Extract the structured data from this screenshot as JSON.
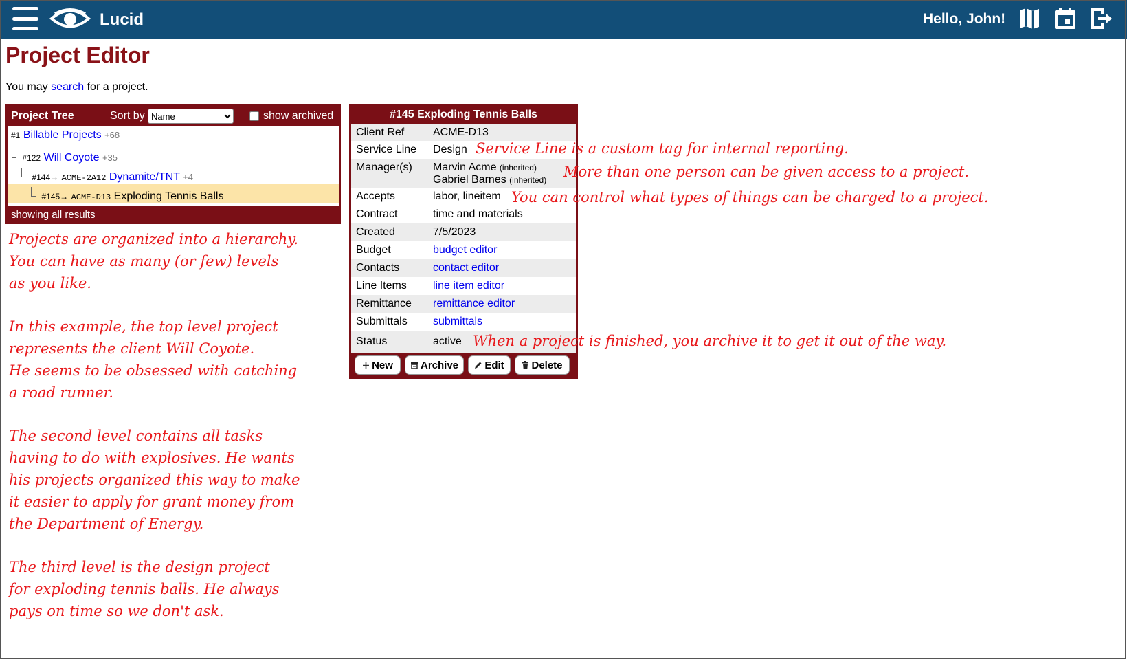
{
  "app": {
    "name": "Lucid",
    "greeting": "Hello, John!"
  },
  "header_icons": [
    "hamburger-menu-icon",
    "eye-logo-icon",
    "map-icon",
    "calendar-icon",
    "logout-icon"
  ],
  "page": {
    "title": "Project Editor",
    "intro": {
      "before": "You may ",
      "link": "search",
      "after": " for a project."
    }
  },
  "tree": {
    "title": "Project Tree",
    "sort_label": "Sort by",
    "sort_value": "Name",
    "show_archived_label": "show archived",
    "show_archived_checked": false,
    "rows": [
      {
        "num": "#1",
        "ref": "",
        "name": "Billable Projects",
        "count": "+68",
        "selected": false,
        "is_link": true
      },
      {
        "num": "#122",
        "ref": "",
        "name": "Will Coyote",
        "count": "+35",
        "selected": false,
        "is_link": true
      },
      {
        "num": "#144→",
        "ref": "ACME-2A12",
        "name": "Dynamite/TNT",
        "count": "+4",
        "selected": false,
        "is_link": true
      },
      {
        "num": "#145→",
        "ref": "ACME-D13",
        "name": "Exploding Tennis Balls",
        "count": "",
        "selected": true,
        "is_link": false
      }
    ],
    "footer": "showing all results"
  },
  "details": {
    "title": "#145 Exploding Tennis Balls",
    "client_ref": {
      "label": "Client Ref",
      "value": "ACME-D13"
    },
    "service_line": {
      "label": "Service Line",
      "value": "Design"
    },
    "managers": {
      "label": "Manager(s)",
      "people": [
        {
          "name": "Marvin Acme",
          "note": "(inherited)"
        },
        {
          "name": "Gabriel Barnes",
          "note": "(inherited)"
        }
      ]
    },
    "accepts": {
      "label": "Accepts",
      "value": "labor, lineitem"
    },
    "contract": {
      "label": "Contract",
      "value": "time and materials"
    },
    "created": {
      "label": "Created",
      "value": "7/5/2023"
    },
    "budget": {
      "label": "Budget",
      "value": "budget editor"
    },
    "contacts": {
      "label": "Contacts",
      "value": "contact editor"
    },
    "line_items": {
      "label": "Line Items",
      "value": "line item editor"
    },
    "remittance": {
      "label": "Remittance",
      "value": "remittance editor"
    },
    "submittals": {
      "label": "Submittals",
      "value": "submittals"
    },
    "status": {
      "label": "Status",
      "value": "active"
    }
  },
  "actions": {
    "new": "New",
    "archive": "Archive",
    "edit": "Edit",
    "delete": "Delete"
  },
  "annotations": {
    "service_line": "Service Line is a custom tag for internal reporting.",
    "managers": "More than one person can be given access to a project.",
    "accepts": "You can control what types of things can be charged to a project.",
    "status": "When a project is finished, you archive it to get it out of the way.",
    "hierarchy": "Projects are organized into a hierarchy.\nYou can have as many (or few) levels\nas you like.",
    "top_level": "In this example, the top level project\nrepresents the client Will Coyote.\nHe seems to be obsessed with catching\na road runner.",
    "second_level": "The second level contains all tasks\nhaving to do with explosives. He wants\nhis projects organized this way to make\nit easier to apply for grant money from\nthe Department of Energy.",
    "third_level": "The third level is the design project\nfor exploding tennis balls. He always\npays on time so we don't ask."
  },
  "colors": {
    "header_bg": "#124e78",
    "title": "#8a1218",
    "panel": "#7a0f16",
    "selected_row": "#fce4a8",
    "annotation": "#e8191c",
    "link": "#0000ee"
  }
}
